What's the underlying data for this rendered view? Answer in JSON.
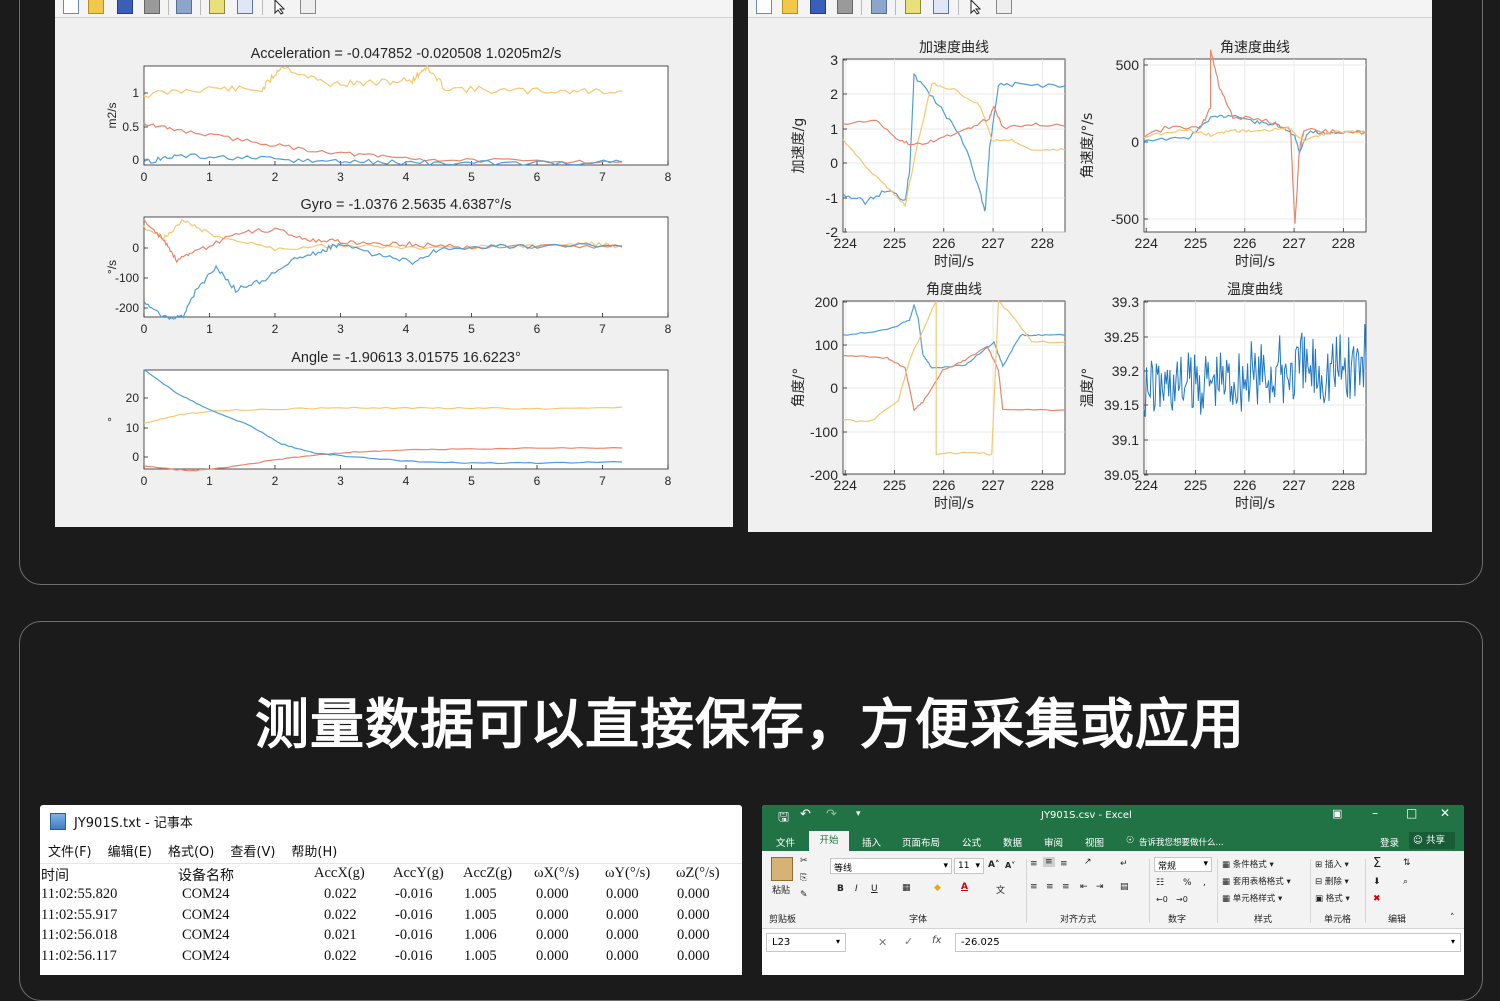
{
  "headline": "测量数据可以直接保存，方便采集或应用",
  "matlab1": {
    "charts": [
      {
        "title": "Acceleration = -0.047852   -0.020508     1.0205m2/s",
        "ylabel": "m2/s",
        "yticks": [
          "1",
          "0.5",
          "0"
        ],
        "xticks": [
          "0",
          "1",
          "2",
          "3",
          "4",
          "5",
          "6",
          "7",
          "8"
        ]
      },
      {
        "title": "Gyro = -1.0376     2.5635     4.6387°/s",
        "ylabel": "°/s",
        "yticks": [
          "0",
          "-100",
          "-200"
        ],
        "xticks": [
          "0",
          "1",
          "2",
          "3",
          "4",
          "5",
          "6",
          "7",
          "8"
        ]
      },
      {
        "title": "Angle = -1.90613     3.01575     16.6223°",
        "ylabel": "°",
        "yticks": [
          "20",
          "10",
          "0"
        ],
        "xticks": [
          "0",
          "1",
          "2",
          "3",
          "4",
          "5",
          "6",
          "7",
          "8"
        ]
      }
    ]
  },
  "matlab2": {
    "charts": [
      {
        "title": "加速度曲线",
        "ylabel": "加速度/g",
        "xlabel": "时间/s",
        "yticks": [
          "3",
          "2",
          "1",
          "0",
          "-1",
          "-2"
        ],
        "xticks": [
          "224",
          "225",
          "226",
          "227",
          "228"
        ]
      },
      {
        "title": "角速度曲线",
        "ylabel": "角速度/°/s",
        "xlabel": "时间/s",
        "yticks": [
          "500",
          "0",
          "-500"
        ],
        "xticks": [
          "224",
          "225",
          "226",
          "227",
          "228"
        ]
      },
      {
        "title": "角度曲线",
        "ylabel": "角度/°",
        "xlabel": "时间/s",
        "yticks": [
          "200",
          "100",
          "0",
          "-100",
          "-200"
        ],
        "xticks": [
          "224",
          "225",
          "226",
          "227",
          "228"
        ]
      },
      {
        "title": "温度曲线",
        "ylabel": "温度/°",
        "xlabel": "时间/s",
        "yticks": [
          "39.3",
          "39.25",
          "39.2",
          "39.15",
          "39.1",
          "39.05"
        ],
        "xticks": [
          "224",
          "225",
          "226",
          "227",
          "228"
        ]
      }
    ]
  },
  "colors": {
    "blue": "#4f9fd8",
    "orange": "#e8866a",
    "yellow": "#f5c870",
    "temp": "#1f77c4",
    "excel": "#217346"
  },
  "notepad": {
    "title": "JY901S.txt - 记事本",
    "menu": [
      "文件(F)",
      "编辑(E)",
      "格式(O)",
      "查看(V)",
      "帮助(H)"
    ],
    "headers": [
      "时间",
      "设备名称",
      "AccX(g)",
      "AccY(g)",
      "AccZ(g)",
      "ωX(°/s)",
      "ωY(°/s)",
      "ωZ(°/s)"
    ],
    "rows": [
      [
        "11:02:55.820",
        "COM24",
        "0.022",
        "-0.016",
        "1.005",
        "0.000",
        "0.000",
        "0.000"
      ],
      [
        "11:02:55.917",
        "COM24",
        "0.022",
        "-0.016",
        "1.005",
        "0.000",
        "0.000",
        "0.000"
      ],
      [
        "11:02:56.018",
        "COM24",
        "0.021",
        "-0.016",
        "1.006",
        "0.000",
        "0.000",
        "0.000"
      ],
      [
        "11:02:56.117",
        "COM24",
        "0.022",
        "-0.016",
        "1.005",
        "0.000",
        "0.000",
        "0.000"
      ]
    ]
  },
  "excel": {
    "title": "JY901S.csv - Excel",
    "tabs": [
      "文件",
      "开始",
      "插入",
      "页面布局",
      "公式",
      "数据",
      "审阅",
      "视图"
    ],
    "tell_me": "告诉我您想要做什么...",
    "login": "登录",
    "share": "共享",
    "font_name": "等线",
    "font_size": "11",
    "number_format": "常规",
    "groups": [
      "剪贴板",
      "字体",
      "对齐方式",
      "数字",
      "样式",
      "单元格",
      "编辑"
    ],
    "paste": "粘贴",
    "styles": [
      "条件格式",
      "套用表格格式",
      "单元格样式"
    ],
    "cells": [
      "插入",
      "删除",
      "格式"
    ],
    "name_box": "L23",
    "formula": "-26.025"
  }
}
